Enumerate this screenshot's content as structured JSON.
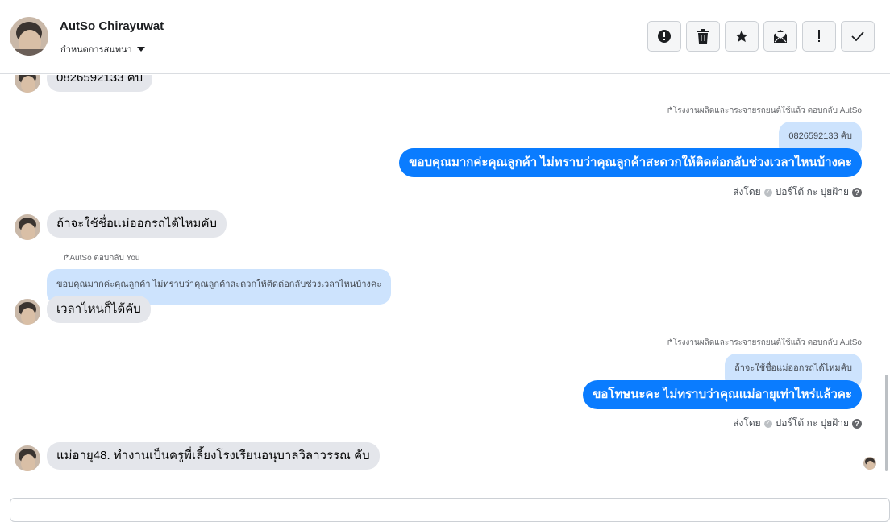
{
  "header": {
    "contact_name": "AutSo Chirayuwat",
    "assign_label": "กำหนดการสนทนา",
    "toolbar": [
      "alert-circle-icon",
      "trash-icon",
      "star-icon",
      "mark-unread-icon",
      "exclamation-icon",
      "check-icon"
    ]
  },
  "messages": {
    "m1": {
      "text": "0826592133 คับ"
    },
    "m2": {
      "reply_note": "โรงงานผลิตและกระจายรถยนต์ใช้แล้ว ตอบกลับ AutSo",
      "quote": "0826592133 คับ",
      "text": "ขอบคุณมากค่ะคุณลูกค้า ไม่ทราบว่าคุณลูกค้าสะดวกให้ติดต่อกลับช่วงเวลาไหนบ้างคะ",
      "sent_by": "ส่งโดย",
      "sender": "ปอร์โต้ กะ ปุยฝ้าย"
    },
    "m3": {
      "text": "ถ้าจะใช้ชื่อแม่ออกรถได้ไหมคับ"
    },
    "m4": {
      "reply_note": "AutSo ตอบกลับ You",
      "quote": "ขอบคุณมากค่ะคุณลูกค้า ไม่ทราบว่าคุณลูกค้าสะดวกให้ติดต่อกลับช่วงเวลาไหนบ้างคะ",
      "text": "เวลาไหนก็ได้คับ"
    },
    "m5": {
      "reply_note": "โรงงานผลิตและกระจายรถยนต์ใช้แล้ว ตอบกลับ AutSo",
      "quote": "ถ้าจะใช้ชื่อแม่ออกรถได้ไหมคับ",
      "text": "ขอโทษนะคะ ไม่ทราบว่าคุณแม่อายุเท่าไหร่แล้วคะ",
      "sent_by": "ส่งโดย",
      "sender": "ปอร์โต้ กะ ปุยฝ้าย"
    },
    "m6": {
      "text": "แม่อายุ48. ทำงานเป็นครูพี่เลี้ยงโรงเรียนอนุบาลวิลาวรรณ คับ"
    }
  },
  "colors": {
    "outgoing": "#0a7cff",
    "incoming": "#e4e6eb",
    "quote": "#cde3fd"
  }
}
